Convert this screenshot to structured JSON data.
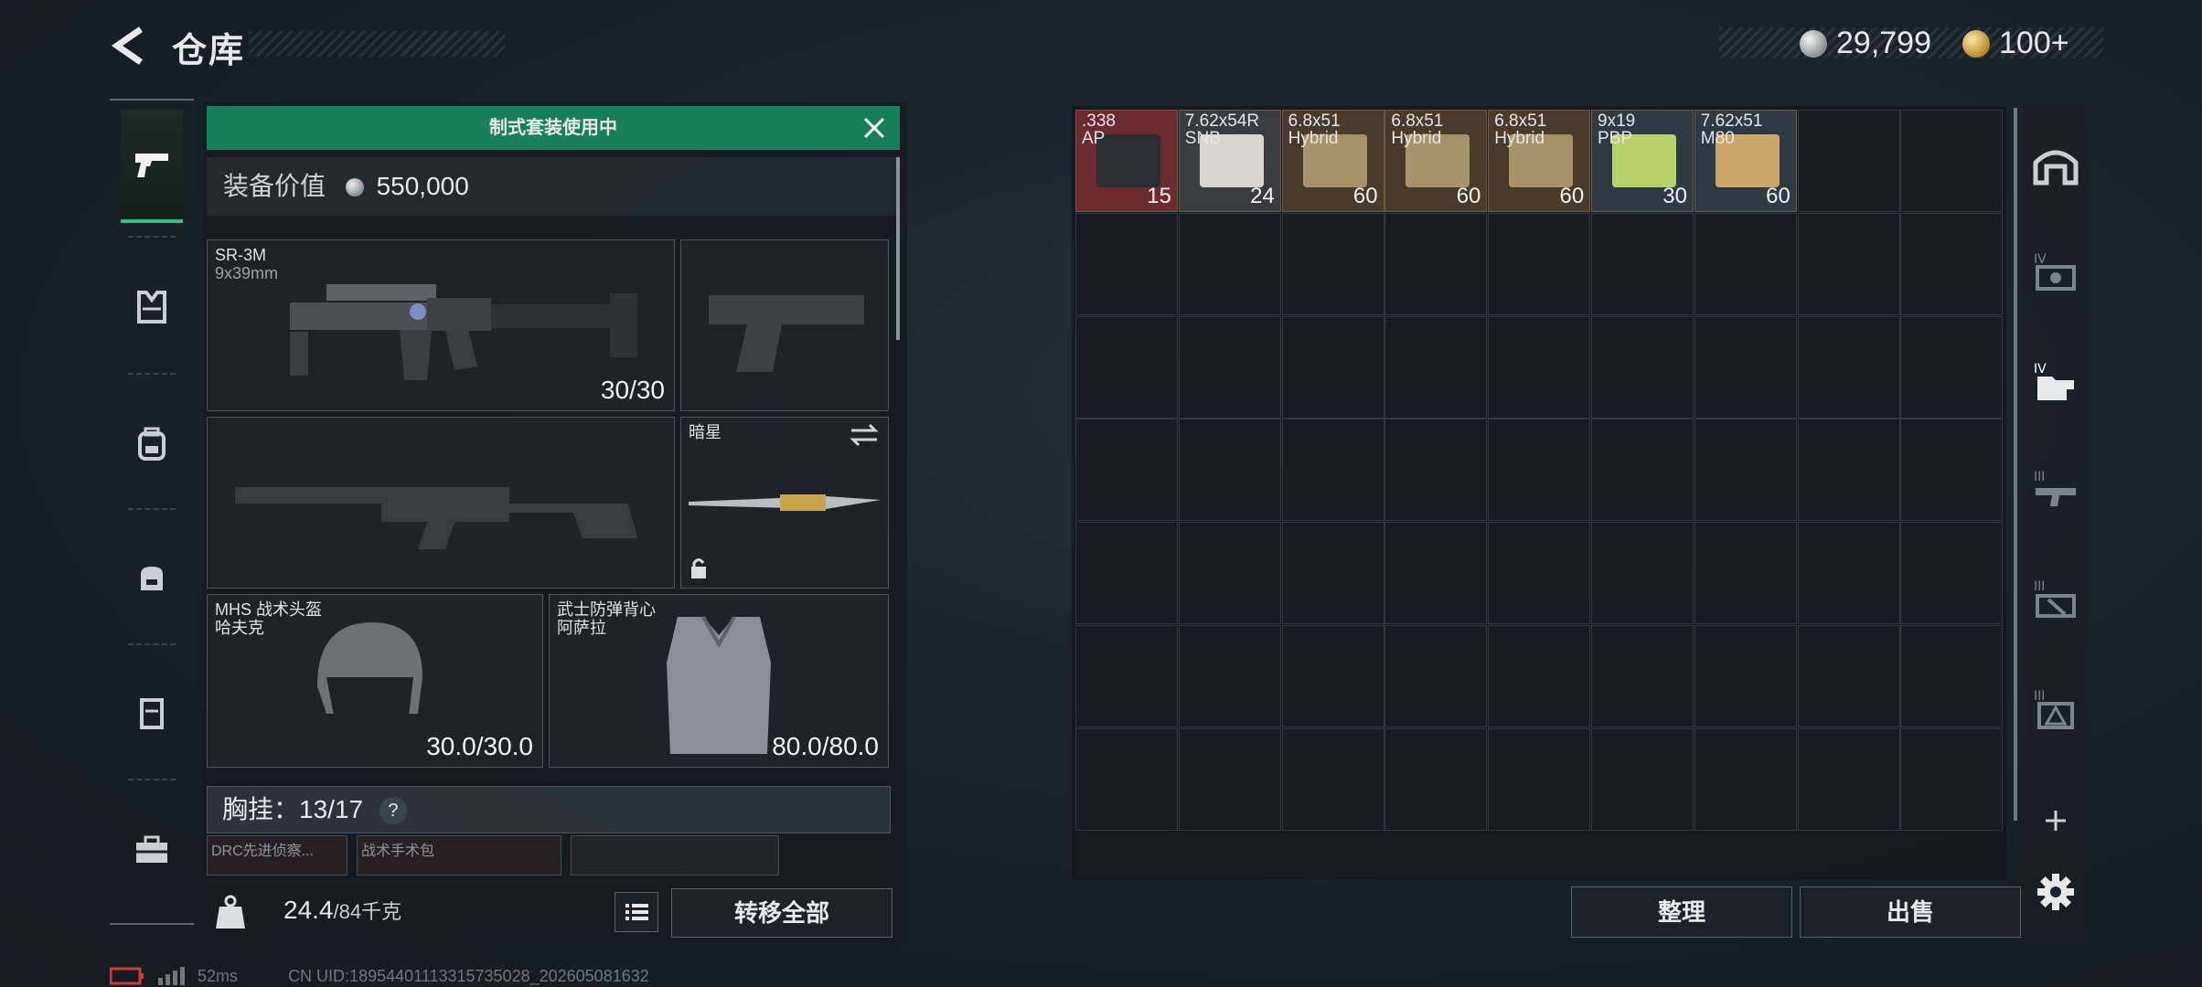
{
  "header": {
    "title": "仓库",
    "currencies": [
      {
        "name": "silver-coin-icon",
        "value": "29,799"
      },
      {
        "name": "gold-coin-icon",
        "value": "100+"
      }
    ]
  },
  "left_nav": [
    "pistol-icon",
    "vest-icon",
    "backpack-icon",
    "bag-icon",
    "case-icon",
    "toolbox-icon"
  ],
  "loadout": {
    "banner": "制式套装使用中",
    "value_label": "装备价值",
    "value": "550,000",
    "primary": {
      "name": "SR-3M",
      "caliber": "9x39mm",
      "ammo": "30/30"
    },
    "melee": {
      "name": "暗星"
    },
    "helmet": {
      "name": "MHS 战术头盔",
      "sub": "哈夫克",
      "durability": "30.0/30.0"
    },
    "armor": {
      "name": "武士防弹背心",
      "sub": "阿萨拉",
      "durability": "80.0/80.0"
    },
    "chest_rig": {
      "label": "胸挂：",
      "value": "13/17",
      "help": "?"
    },
    "mini_slots": [
      "DRC先进侦察...",
      "战术手术包",
      ""
    ],
    "weight": {
      "current": "24.4",
      "max": "/84千克"
    },
    "transfer_all": "转移全部"
  },
  "stash": {
    "items": [
      {
        "t1": ".338",
        "t2": "AP",
        "count": "15",
        "color": "#6b2b2f"
      },
      {
        "t1": "7.62x54R",
        "t2": "SNB",
        "count": "24",
        "color": "#3a3b3f"
      },
      {
        "t1": "6.8x51",
        "t2": "Hybrid",
        "count": "60",
        "color": "#4a3a2a"
      },
      {
        "t1": "6.8x51",
        "t2": "Hybrid",
        "count": "60",
        "color": "#4a3a2a"
      },
      {
        "t1": "6.8x51",
        "t2": "Hybrid",
        "count": "60",
        "color": "#4a3a2a"
      },
      {
        "t1": "9x19",
        "t2": "PBP",
        "count": "30",
        "color": "#2f3a45"
      },
      {
        "t1": "7.62x51",
        "t2": "M80",
        "count": "60",
        "color": "#2f3a45"
      }
    ],
    "sort_label": "整理",
    "sell_label": "出售"
  },
  "right_nav": [
    "safehouse-icon",
    "level-iv-case-icon",
    "level-iv-folder-icon",
    "level-iii-gun-icon",
    "level-iii-tool-icon",
    "level-iii-box-icon",
    "add-icon",
    "settings-icon"
  ],
  "status": {
    "ping": "52ms",
    "uid": "CN UID:18954401113315735028_202605081632"
  }
}
